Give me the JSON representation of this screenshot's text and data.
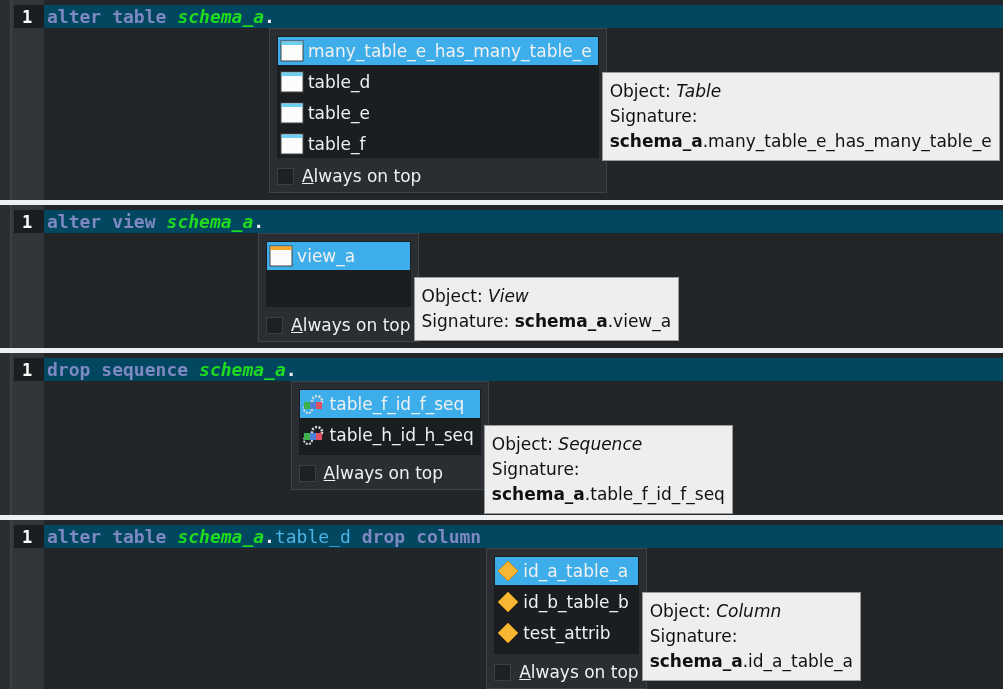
{
  "panels": [
    {
      "line_number": "1",
      "code": [
        {
          "kind": "keyword",
          "text": "alter"
        },
        {
          "kind": "keyword",
          "text": "table"
        },
        {
          "kind": "schema",
          "text": "schema_a"
        },
        {
          "kind": "punct",
          "text": "."
        }
      ],
      "popup": {
        "items": [
          {
            "kind": "table",
            "label": "many_table_e_has_many_table_e",
            "selected": true
          },
          {
            "kind": "table",
            "label": "table_d",
            "selected": false
          },
          {
            "kind": "table",
            "label": "table_e",
            "selected": false
          },
          {
            "kind": "table",
            "label": "table_f",
            "selected": false
          }
        ],
        "always_on_top": {
          "label": "Always on top",
          "checked": false
        }
      },
      "tooltip": {
        "object": "Object: *Table*",
        "signature_label": "Signature:",
        "signature": "**schema_a**.many_table_e_has_many_table_e",
        "wrapped": true
      }
    },
    {
      "line_number": "1",
      "code": [
        {
          "kind": "keyword",
          "text": "alter"
        },
        {
          "kind": "keyword",
          "text": "view"
        },
        {
          "kind": "schema",
          "text": "schema_a"
        },
        {
          "kind": "punct",
          "text": "."
        }
      ],
      "popup": {
        "items": [
          {
            "kind": "view",
            "label": "view_a",
            "selected": true
          }
        ],
        "always_on_top": {
          "label": "Always on top",
          "checked": false
        }
      },
      "tooltip": {
        "object": "Object: *View*",
        "signature_label": "Signature:",
        "signature": "**schema_a**.view_a",
        "wrapped": false
      }
    },
    {
      "line_number": "1",
      "code": [
        {
          "kind": "keyword",
          "text": "drop"
        },
        {
          "kind": "keyword",
          "text": "sequence"
        },
        {
          "kind": "schema",
          "text": "schema_a"
        },
        {
          "kind": "punct",
          "text": "."
        }
      ],
      "popup": {
        "items": [
          {
            "kind": "sequence",
            "label": "table_f_id_f_seq",
            "selected": true
          },
          {
            "kind": "sequence",
            "label": "table_h_id_h_seq",
            "selected": false
          }
        ],
        "always_on_top": {
          "label": "Always on top",
          "checked": false
        }
      },
      "tooltip": {
        "object": "Object: *Sequence*",
        "signature_label": "Signature:",
        "signature": "**schema_a**.table_f_id_f_seq",
        "wrapped": true
      }
    },
    {
      "line_number": "1",
      "code": [
        {
          "kind": "keyword",
          "text": "alter"
        },
        {
          "kind": "keyword",
          "text": "table"
        },
        {
          "kind": "schema",
          "text": "schema_a"
        },
        {
          "kind": "punct",
          "text": "."
        },
        {
          "kind": "identifier",
          "text": "table_d"
        },
        {
          "kind": "keyword",
          "text": "drop"
        },
        {
          "kind": "keyword",
          "text": "column"
        }
      ],
      "popup": {
        "items": [
          {
            "kind": "column",
            "label": "id_a_table_a",
            "selected": true
          },
          {
            "kind": "column",
            "label": "id_b_table_b",
            "selected": false
          },
          {
            "kind": "column",
            "label": "test_attrib",
            "selected": false
          }
        ],
        "always_on_top": {
          "label": "Always on top",
          "checked": false
        }
      },
      "tooltip": {
        "object": "Object: *Column*",
        "signature_label": "Signature:",
        "signature": "**schema_a**.id_a_table_a",
        "wrapped": true
      }
    }
  ]
}
